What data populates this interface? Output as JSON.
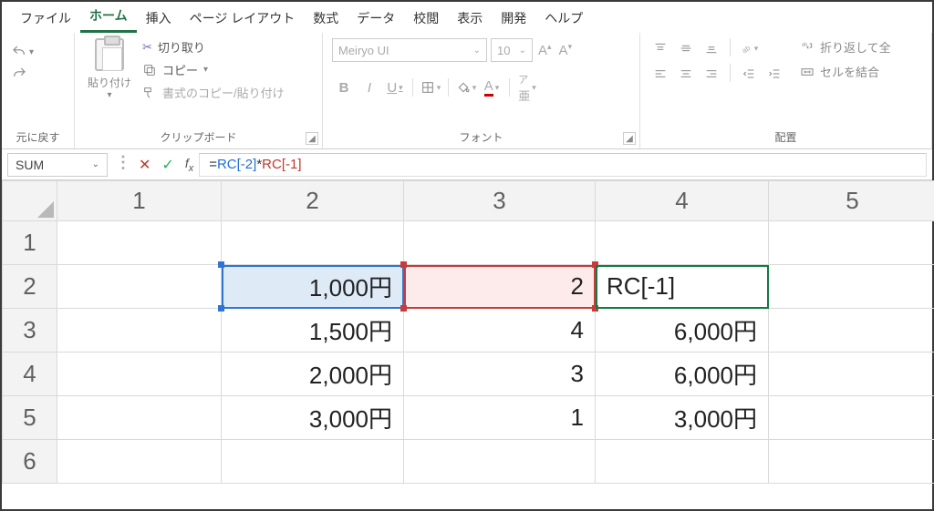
{
  "menu": {
    "items": [
      "ファイル",
      "ホーム",
      "挿入",
      "ページ レイアウト",
      "数式",
      "データ",
      "校閲",
      "表示",
      "開発",
      "ヘルプ"
    ],
    "active_index": 1
  },
  "ribbon": {
    "undo_label": "元に戻す",
    "clipboard": {
      "label": "クリップボード",
      "paste": "貼り付け",
      "cut": "切り取り",
      "copy": "コピー",
      "format_painter": "書式のコピー/貼り付け"
    },
    "font": {
      "label": "フォント",
      "name_placeholder": "Meiryo UI",
      "size_placeholder": "10"
    },
    "alignment": {
      "label": "配置",
      "wrap": "折り返して全",
      "merge": "セルを結合"
    }
  },
  "formula_bar": {
    "name_box": "SUM",
    "formula_prefix": "=",
    "formula_ref1": "RC[-2]",
    "formula_op": "*",
    "formula_ref2": "RC[-1]"
  },
  "grid": {
    "col_headers": [
      "1",
      "2",
      "3",
      "4",
      "5"
    ],
    "row_headers": [
      "1",
      "2",
      "3",
      "4",
      "5",
      "6"
    ],
    "selected_col_index": 3,
    "selected_row_index": 1,
    "rows": [
      {
        "c2": "",
        "c3": "",
        "c4": ""
      },
      {
        "c2": "1,000円",
        "c3": "2",
        "c4": "RC[-1]"
      },
      {
        "c2": "1,500円",
        "c3": "4",
        "c4": "6,000円"
      },
      {
        "c2": "2,000円",
        "c3": "3",
        "c4": "6,000円"
      },
      {
        "c2": "3,000円",
        "c3": "1",
        "c4": "3,000円"
      },
      {
        "c2": "",
        "c3": "",
        "c4": ""
      }
    ]
  }
}
